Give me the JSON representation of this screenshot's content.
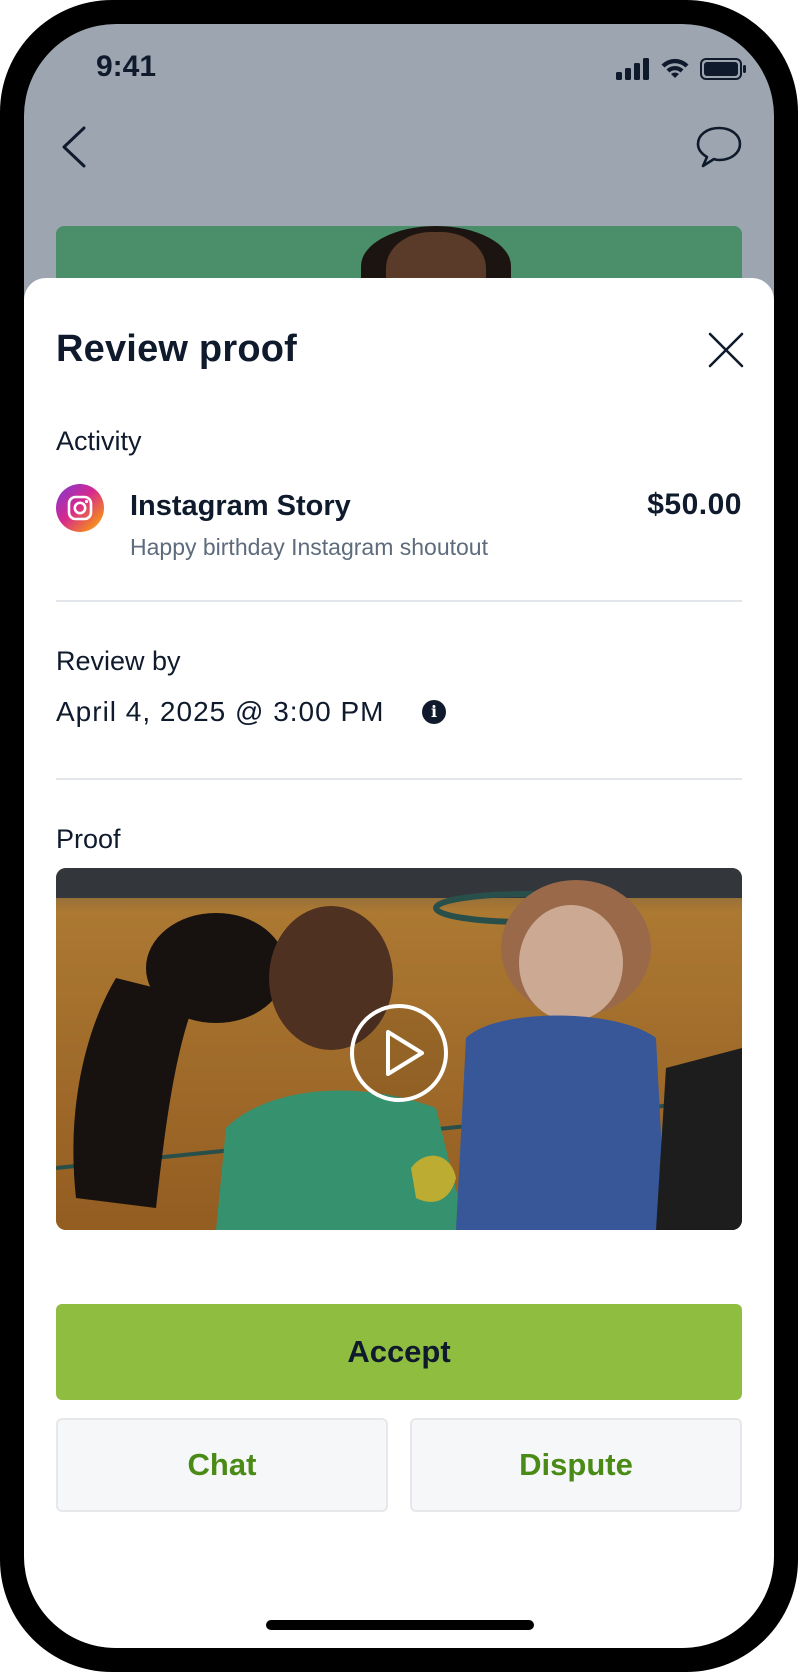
{
  "status_bar": {
    "time": "9:41"
  },
  "sheet": {
    "title": "Review proof",
    "activity": {
      "section_label": "Activity",
      "name": "Instagram Story",
      "description": "Happy birthday Instagram shoutout",
      "price": "$50.00",
      "platform_icon": "instagram-icon"
    },
    "review_by": {
      "section_label": "Review by",
      "date": "April 4, 2025 @ 3:00 PM",
      "info_glyph": "i"
    },
    "proof": {
      "section_label": "Proof",
      "media_type": "video",
      "icon": "play-icon"
    },
    "actions": {
      "accept_label": "Accept",
      "chat_label": "Chat",
      "dispute_label": "Dispute"
    }
  },
  "colors": {
    "accent_green": "#8fbd3f",
    "secondary_text_green": "#4a8a16",
    "dark_text": "#0f1b2d",
    "muted_text": "#5d6b7c"
  }
}
